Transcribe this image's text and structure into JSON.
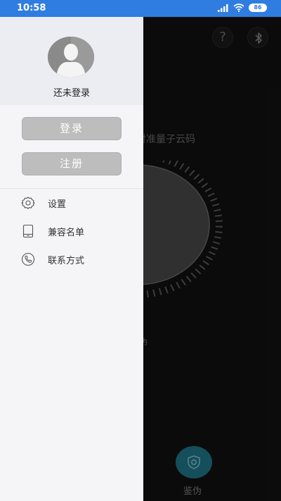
{
  "status_bar": {
    "time": "10:58",
    "battery": "86"
  },
  "background": {
    "help_glyph": "?",
    "prompt_text": "请对准量子云码",
    "sub_text": "伪",
    "verify_label": "鉴伪"
  },
  "drawer": {
    "login_status": "还未登录",
    "login_button": "登录",
    "register_button": "注册",
    "menu": [
      {
        "label": "设置",
        "icon": "gear-icon"
      },
      {
        "label": "兼容名单",
        "icon": "tablet-icon"
      },
      {
        "label": "联系方式",
        "icon": "phone-icon"
      }
    ]
  },
  "colors": {
    "status_bar": "#2f7de0",
    "drawer_bg": "#f5f5f8",
    "button_bg": "#bdbdbd",
    "verify_button": "#1f7a8c"
  }
}
